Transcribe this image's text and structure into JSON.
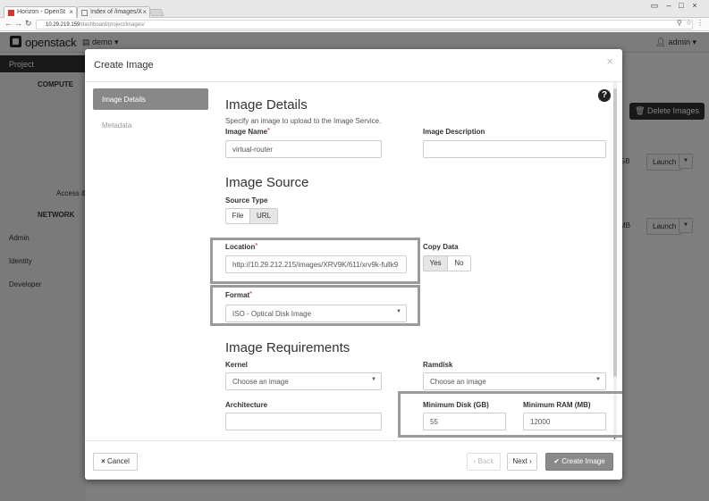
{
  "browser": {
    "tabs": [
      {
        "label": "Horizon - OpenSt"
      },
      {
        "label": "Index of /images/X"
      }
    ],
    "url_host": "10.29.219.159",
    "url_path": "/dashboard/project/images/"
  },
  "header": {
    "brand": "openstack",
    "project": "demo ▾",
    "user": "admin ▾"
  },
  "sidebar": {
    "project": "Project",
    "compute": "COMPUTE",
    "access": "Access &",
    "network": "NETWORK",
    "admin": "Admin",
    "identity": "Identity",
    "developer": "Developer"
  },
  "page": {
    "delete_images": "Delete Images",
    "row1_size": "GB",
    "row2_size": "MB",
    "launch": "Launch"
  },
  "modal": {
    "title": "Create Image",
    "nav": [
      "Image Details",
      "Metadata"
    ],
    "details": {
      "heading": "Image Details",
      "hint": "Specify an image to upload to the Image Service.",
      "image_name_label": "Image Name",
      "image_name_value": "virtual-router",
      "image_desc_label": "Image Description",
      "image_desc_value": ""
    },
    "source": {
      "heading": "Image Source",
      "source_type_label": "Source Type",
      "file_btn": "File",
      "url_btn": "URL",
      "location_label": "Location",
      "location_value": "http://10.29.212.215/images/XRV9K/611/xrv9k-fullk9",
      "copy_data_label": "Copy Data",
      "yes_btn": "Yes",
      "no_btn": "No",
      "format_label": "Format",
      "format_value": "ISO - Optical Disk Image"
    },
    "requirements": {
      "heading": "Image Requirements",
      "kernel_label": "Kernel",
      "kernel_value": "Choose an image",
      "ramdisk_label": "Ramdisk",
      "ramdisk_value": "Choose an image",
      "arch_label": "Architecture",
      "arch_value": "",
      "min_disk_label": "Minimum Disk (GB)",
      "min_disk_value": "55",
      "min_ram_label": "Minimum RAM (MB)",
      "min_ram_value": "12000"
    },
    "footer": {
      "cancel": "Cancel",
      "back": "Back",
      "next": "Next",
      "create": "Create Image"
    }
  }
}
